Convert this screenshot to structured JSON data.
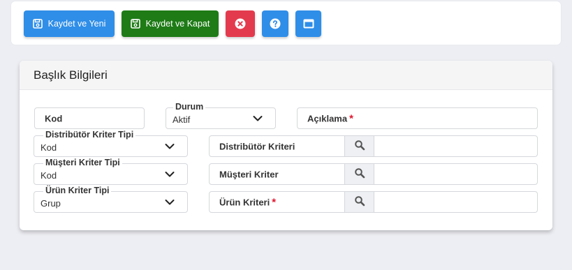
{
  "toolbar": {
    "save_new_label": "Kaydet ve Yeni",
    "save_close_label": "Kaydet ve Kapat",
    "cancel_icon": "close-circle-icon",
    "help_icon": "question-circle-icon",
    "window_icon": "window-icon"
  },
  "colors": {
    "primary": "#2f8ee8",
    "success": "#1e7b16",
    "danger": "#e33b4d",
    "required": "#e0142b"
  },
  "card": {
    "title": "Başlık Bilgileri"
  },
  "form": {
    "kod": {
      "placeholder": "Kod"
    },
    "durum": {
      "label": "Durum",
      "value": "Aktif"
    },
    "aciklama": {
      "placeholder": "Açıklama",
      "required_mark": "*"
    },
    "distributor_kriter_tipi": {
      "label": "Distribütör Kriter Tipi",
      "value": "Kod"
    },
    "distributor_kriteri": {
      "placeholder": "Distribütör Kriteri"
    },
    "musteri_kriter_tipi": {
      "label": "Müşteri Kriter Tipi",
      "value": "Kod"
    },
    "musteri_kriter": {
      "placeholder": "Müşteri Kriter"
    },
    "urun_kriter_tipi": {
      "label": "Ürün Kriter Tipi",
      "value": "Grup"
    },
    "urun_kriteri": {
      "placeholder": "Ürün Kriteri",
      "required_mark": "*"
    }
  }
}
